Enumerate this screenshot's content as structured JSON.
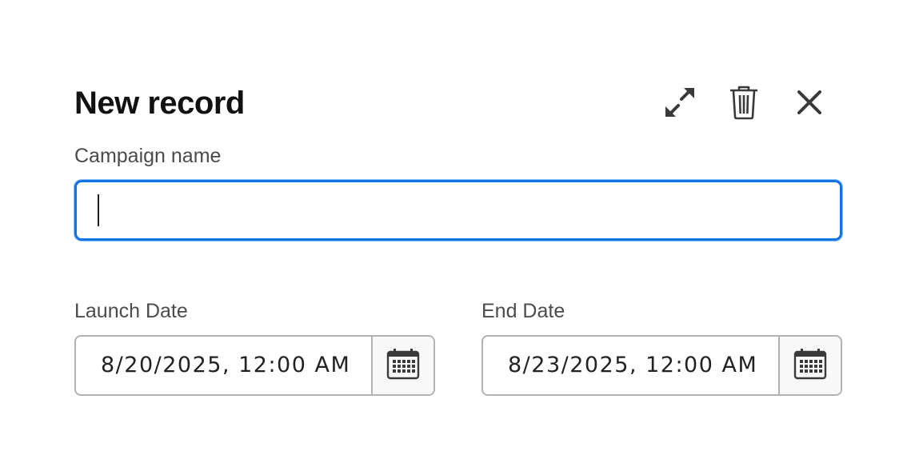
{
  "dialog": {
    "title": "New record",
    "actions": {
      "expand_icon": "expand-arrows-icon",
      "delete_icon": "trash-icon",
      "close_icon": "close-icon"
    }
  },
  "fields": {
    "campaign_name": {
      "label": "Campaign name",
      "value": "",
      "placeholder": ""
    },
    "launch_date": {
      "label": "Launch Date",
      "value": "8/20/2025, 12:00 AM",
      "calendar_icon": "calendar-icon"
    },
    "end_date": {
      "label": "End Date",
      "value": "8/23/2025, 12:00 AM",
      "calendar_icon": "calendar-icon"
    }
  },
  "colors": {
    "focus_border": "#1473e6",
    "field_border": "#b3b3b3",
    "label_text": "#4b4b4b",
    "title_text": "#111111"
  }
}
